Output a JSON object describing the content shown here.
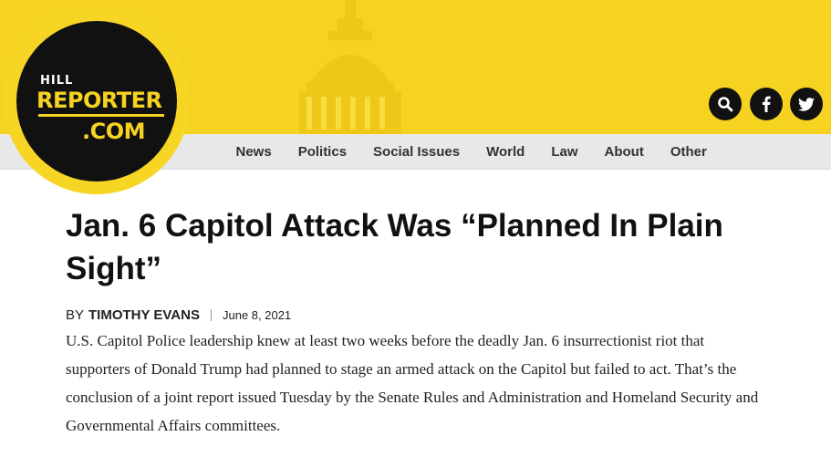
{
  "logo": {
    "line1": "HILL",
    "line2": "REPORTER",
    "line3": ".COM"
  },
  "nav": {
    "items": [
      {
        "label": "News"
      },
      {
        "label": "Politics"
      },
      {
        "label": "Social Issues"
      },
      {
        "label": "World"
      },
      {
        "label": "Law"
      },
      {
        "label": "About"
      },
      {
        "label": "Other"
      }
    ]
  },
  "header_icons": [
    "search-icon",
    "facebook-icon",
    "twitter-icon"
  ],
  "article": {
    "title": "Jan. 6 Capitol Attack Was “Planned In Plain Sight”",
    "by_label": "BY",
    "author": "TIMOTHY EVANS",
    "date": "June 8, 2021",
    "body": "U.S. Capitol Police leadership knew at least two weeks before the deadly Jan. 6 insurrectionist riot that supporters of Donald Trump had planned to stage an armed attack on the Capitol but failed to act. That’s the conclusion of a joint report issued Tuesday by the Senate Rules and Administration and Homeland Security and Governmental Affairs committees."
  },
  "colors": {
    "brand_yellow": "#f6d321",
    "logo_black": "#111111",
    "nav_bg": "#e8e8e8"
  }
}
